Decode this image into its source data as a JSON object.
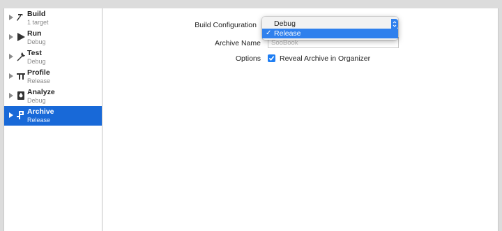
{
  "sidebar": {
    "items": [
      {
        "title": "Build",
        "subtitle": "1 target",
        "icon": "hammer-icon"
      },
      {
        "title": "Run",
        "subtitle": "Debug",
        "icon": "play-icon"
      },
      {
        "title": "Test",
        "subtitle": "Debug",
        "icon": "wrench-icon"
      },
      {
        "title": "Profile",
        "subtitle": "Release",
        "icon": "gauge-icon"
      },
      {
        "title": "Analyze",
        "subtitle": "Debug",
        "icon": "analyze-icon"
      },
      {
        "title": "Archive",
        "subtitle": "Release",
        "icon": "archive-icon"
      }
    ],
    "selected": "Archive"
  },
  "form": {
    "build_configuration_label": "Build Configuration",
    "archive_name_label": "Archive Name",
    "archive_name_placeholder": "SooBook",
    "options_label": "Options",
    "reveal_archive_label": "Reveal Archive in Organizer",
    "reveal_archive_checked": true
  },
  "configuration_menu": {
    "options": [
      "Debug",
      "Release"
    ],
    "selected": "Release",
    "check_glyph": "✓"
  },
  "colors": {
    "selection": "#1869d8",
    "menu_highlight": "#2f80ed",
    "checkbox": "#1f7ef3"
  }
}
